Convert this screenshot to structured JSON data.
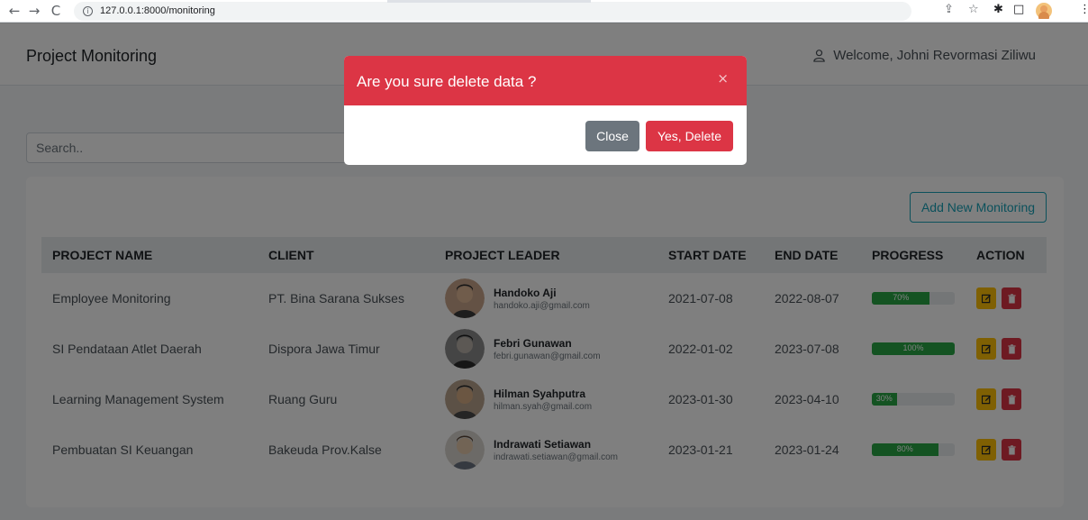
{
  "browser": {
    "url": "127.0.0.1:8000/monitoring"
  },
  "app": {
    "title": "Project Monitoring",
    "welcome": "Welcome, Johni Revormasi Ziliwu"
  },
  "search": {
    "placeholder": "Search.."
  },
  "actions": {
    "add_label": "Add New Monitoring"
  },
  "table": {
    "headers": [
      "PROJECT NAME",
      "CLIENT",
      "PROJECT LEADER",
      "START DATE",
      "END DATE",
      "PROGRESS",
      "ACTION"
    ],
    "rows": [
      {
        "project": "Employee Monitoring",
        "client": "PT. Bina Sarana Sukses",
        "leader": "Handoko Aji",
        "email": "handoko.aji@gmail.com",
        "start": "2021-07-08",
        "end": "2022-08-07",
        "progress": 70,
        "progress_label": "70%"
      },
      {
        "project": "SI Pendataan Atlet Daerah",
        "client": "Dispora Jawa Timur",
        "leader": "Febri Gunawan",
        "email": "febri.gunawan@gmail.com",
        "start": "2022-01-02",
        "end": "2023-07-08",
        "progress": 100,
        "progress_label": "100%"
      },
      {
        "project": "Learning Management System",
        "client": "Ruang Guru",
        "leader": "Hilman Syahputra",
        "email": "hilman.syah@gmail.com",
        "start": "2023-01-30",
        "end": "2023-04-10",
        "progress": 30,
        "progress_label": "30%"
      },
      {
        "project": "Pembuatan SI Keuangan",
        "client": "Bakeuda Prov.Kalse",
        "leader": "Indrawati Setiawan",
        "email": "indrawati.setiawan@gmail.com",
        "start": "2023-01-21",
        "end": "2023-01-24",
        "progress": 80,
        "progress_label": "80%"
      }
    ]
  },
  "modal": {
    "title": "Are you sure delete data ?",
    "close_icon": "×",
    "close_label": "Close",
    "confirm_label": "Yes, Delete"
  },
  "colors": {
    "danger": "#dc3545",
    "warning": "#ffc107",
    "success": "#28a745",
    "info": "#17a2b8",
    "secondary": "#6c757d"
  }
}
